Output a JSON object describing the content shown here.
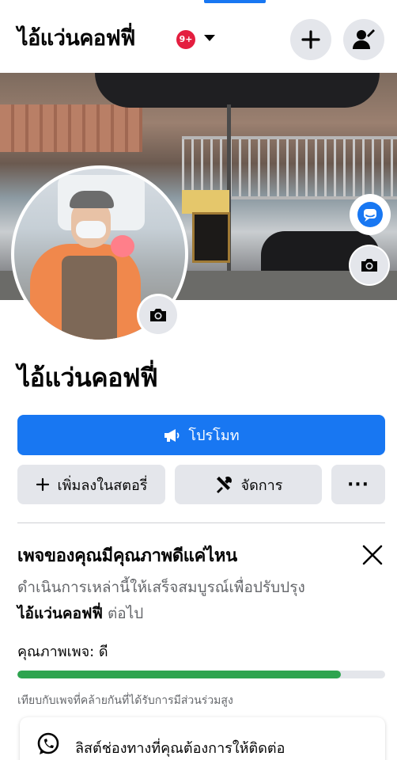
{
  "header": {
    "page_name": "ไอ้แว่นคอฟฟี่",
    "notification_badge": "9+",
    "icons": {
      "dropdown": "chevron-down-icon",
      "create": "plus-icon",
      "profile_switch": "person-switch-icon"
    }
  },
  "cover": {
    "icons": {
      "messenger": "messenger-icon",
      "edit_cover": "camera-icon"
    }
  },
  "profile": {
    "page_name": "ไอ้แว่นคอฟฟี่",
    "icons": {
      "edit_avatar": "camera-icon"
    }
  },
  "actions": {
    "promote_label": "โปรโมท",
    "add_story_label": "เพิ่มลงในสตอรี่",
    "manage_label": "จัดการ",
    "more_label": "···",
    "icons": {
      "promote": "megaphone-icon",
      "add": "plus-icon",
      "manage": "tools-icon",
      "more": "more-icon"
    }
  },
  "quality": {
    "title": "เพจของคุณมีคุณภาพดีแค่ไหน",
    "desc_prefix": "ดำเนินการเหล่านี้ให้เสร็จสมบูรณ์เพื่อปรับปรุง ",
    "desc_page": "ไอ้แว่นคอฟฟี่",
    "desc_suffix": " ต่อไป",
    "label": "คุณภาพเพจ: ดี",
    "progress": 0.88,
    "progress_color": "#2ea44f",
    "compare_text": "เทียบกับเพจที่คล้ายกันที่ได้รับการมีส่วนร่วมสูง"
  },
  "card": {
    "text": "ลิสต์ช่องทางที่คุณต้องการให้ติดต่อ",
    "icon": "whatsapp-icon"
  },
  "colors": {
    "accent": "#1877f2",
    "badge": "#e41e3f",
    "button_bg": "#e4e6eb"
  }
}
